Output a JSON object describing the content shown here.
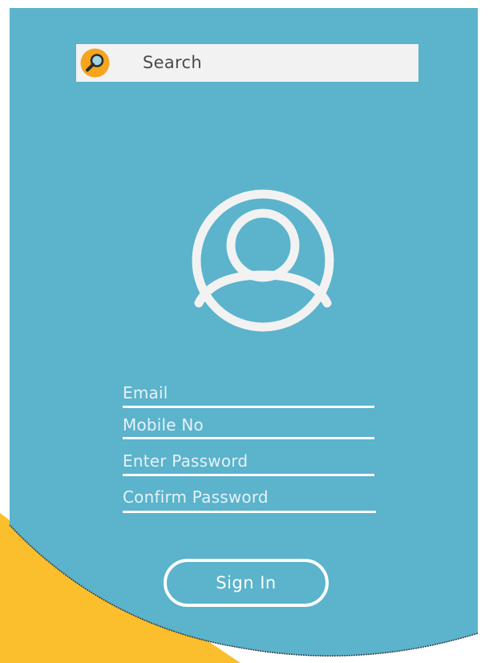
{
  "search": {
    "placeholder": "Search",
    "icon": "search-icon"
  },
  "avatar": {
    "icon": "user-avatar-icon"
  },
  "form": {
    "email_label": "Email",
    "mobile_label": "Mobile No",
    "password_label": "Enter Password",
    "confirm_label": "Confirm Password"
  },
  "signin": {
    "label": "Sign In"
  },
  "colors": {
    "panel": "#5bb3cc",
    "accent": "#fbbe2c",
    "field_text": "#e6f2f7",
    "search_bg": "#f2f2f2",
    "icon_circle": "#f6a51e",
    "avatar_stroke": "#f2f2f2"
  }
}
